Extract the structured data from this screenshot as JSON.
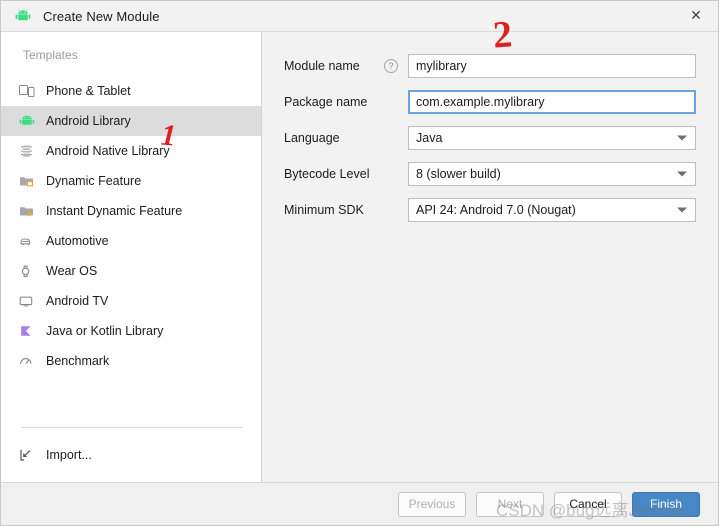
{
  "window": {
    "title": "Create New Module",
    "icon": "android-robot-icon",
    "close_label": "✕"
  },
  "sidebar": {
    "header": "Templates",
    "items": [
      {
        "label": "Phone & Tablet",
        "icon": "phone-tablet-icon",
        "selected": false
      },
      {
        "label": "Android Library",
        "icon": "android-robot-icon",
        "selected": true
      },
      {
        "label": "Android Native Library",
        "icon": "native-chip-icon",
        "selected": false
      },
      {
        "label": "Dynamic Feature",
        "icon": "dynamic-feature-folder-icon",
        "selected": false
      },
      {
        "label": "Instant Dynamic Feature",
        "icon": "instant-dynamic-feature-folder-icon",
        "selected": false
      },
      {
        "label": "Automotive",
        "icon": "car-icon",
        "selected": false
      },
      {
        "label": "Wear OS",
        "icon": "watch-icon",
        "selected": false
      },
      {
        "label": "Android TV",
        "icon": "tv-icon",
        "selected": false
      },
      {
        "label": "Java or Kotlin Library",
        "icon": "kotlin-icon",
        "selected": false
      },
      {
        "label": "Benchmark",
        "icon": "benchmark-gauge-icon",
        "selected": false
      }
    ],
    "import_label": "Import...",
    "import_icon": "import-arrow-icon"
  },
  "form": {
    "module_name": {
      "label": "Module name",
      "value": "mylibrary",
      "help_icon": "help-question-icon",
      "help_glyph": "?"
    },
    "package_name": {
      "label": "Package name",
      "value": "com.example.mylibrary",
      "focused": true
    },
    "language": {
      "label": "Language",
      "value": "Java"
    },
    "bytecode_level": {
      "label": "Bytecode Level",
      "value": "8 (slower build)"
    },
    "minimum_sdk": {
      "label": "Minimum SDK",
      "value": "API 24: Android 7.0 (Nougat)"
    }
  },
  "footer": {
    "previous": "Previous",
    "next": "Next",
    "cancel": "Cancel",
    "finish": "Finish"
  },
  "annotations": {
    "one": "1",
    "two": "2",
    "color": "#e02020"
  },
  "watermark": {
    "text": "CSDN @bug远离Jemma"
  },
  "colors": {
    "accent": "#4787c7",
    "focus_border": "#6aa3e0",
    "selection": "#dcdcdc",
    "panel_bg": "#f2f2f2",
    "android_green": "#3ddc84",
    "kotlin_purple": "#a97bf0"
  }
}
